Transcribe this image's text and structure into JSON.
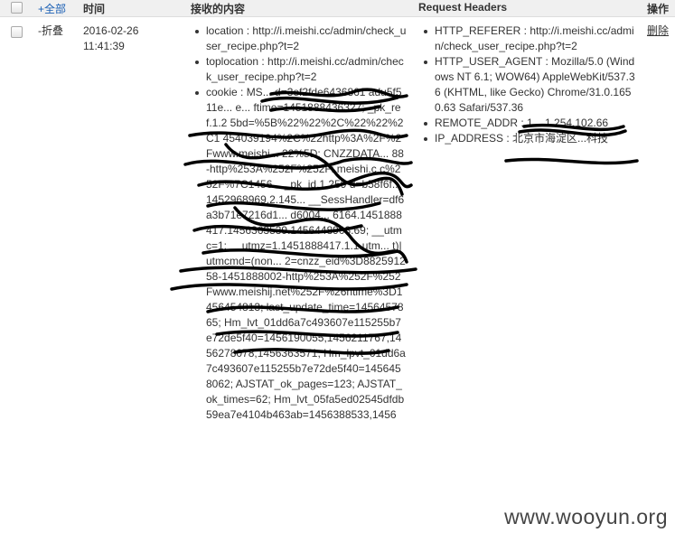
{
  "header": {
    "select_all_label": "+全部",
    "time_label": "时间",
    "content_label": "接收的内容",
    "headers_label": "Request Headers",
    "action_label": "操作"
  },
  "row": {
    "collapse_label": "-折叠",
    "date": "2016-02-26",
    "time": "11:41:39",
    "content": [
      {
        "text": "location : http://i.meishi.cc/admin/check_user_recipe.php?t=2"
      },
      {
        "text": "toplocation : http://i.meishi.cc/admin/check_user_recipe.php?t=2"
      },
      {
        "text": "cookie : MS... d=3ef2fde6436861 adu5f511e... e... ftime=1451888436327; _pk_ref.1.2 5bd=%5B%22%22%2C%22%22%2C1 454039194%2C%22http%3A%2F%2Fwww.meishi... 22%5D; CNZZDATA... 88-http%253A%252F%252Fi.meishi.c c%252F%7C1456... _pk_id.1.259 d=b58f6f... 1452968969.2.145... __SessHandler=df6a3b71e7216d1... d6004... 6164.1451888417.1456363539.1456448908.69; __utmc=1; __utmz=1.1451888417.1.1.utm... t)|utmcmd=(non... 2=cnzz_eid%3D882591258-1451888002-http%253A%252F%252Fwww.meishij.net%252F%26ntime%3D1456454813; last_update_time=1456457865; Hm_lvt_01dd6a7c493607e115255b7e72de5f40=1456190055,1456211767,1456278078,1456363571; Hm_lpvt_01dd6a7c493607e115255b7e72de5f40=1456458062; AJSTAT_ok_pages=123; AJSTAT_ok_times=62; Hm_lvt_05fa5ed02545dfdb59ea7e4104b463ab=1456388533,1456"
      }
    ],
    "headers": [
      {
        "text": "HTTP_REFERER : http://i.meishi.cc/admin/check_user_recipe.php?t=2"
      },
      {
        "text": "HTTP_USER_AGENT : Mozilla/5.0 (Windows NT 6.1; WOW64) AppleWebKit/537.36 (KHTML, like Gecko) Chrome/31.0.1650.63 Safari/537.36"
      },
      {
        "text": "REMOTE_ADDR : 1... 1.254.102.66"
      },
      {
        "text": "IP_ADDRESS : 北京市海淀区...科技"
      }
    ],
    "delete_label": "删除"
  },
  "watermark": "www.wooyun.org",
  "colors": {
    "link": "#1a5fb4",
    "header_bg": "#f0f0f0",
    "scribble": "#000000"
  }
}
